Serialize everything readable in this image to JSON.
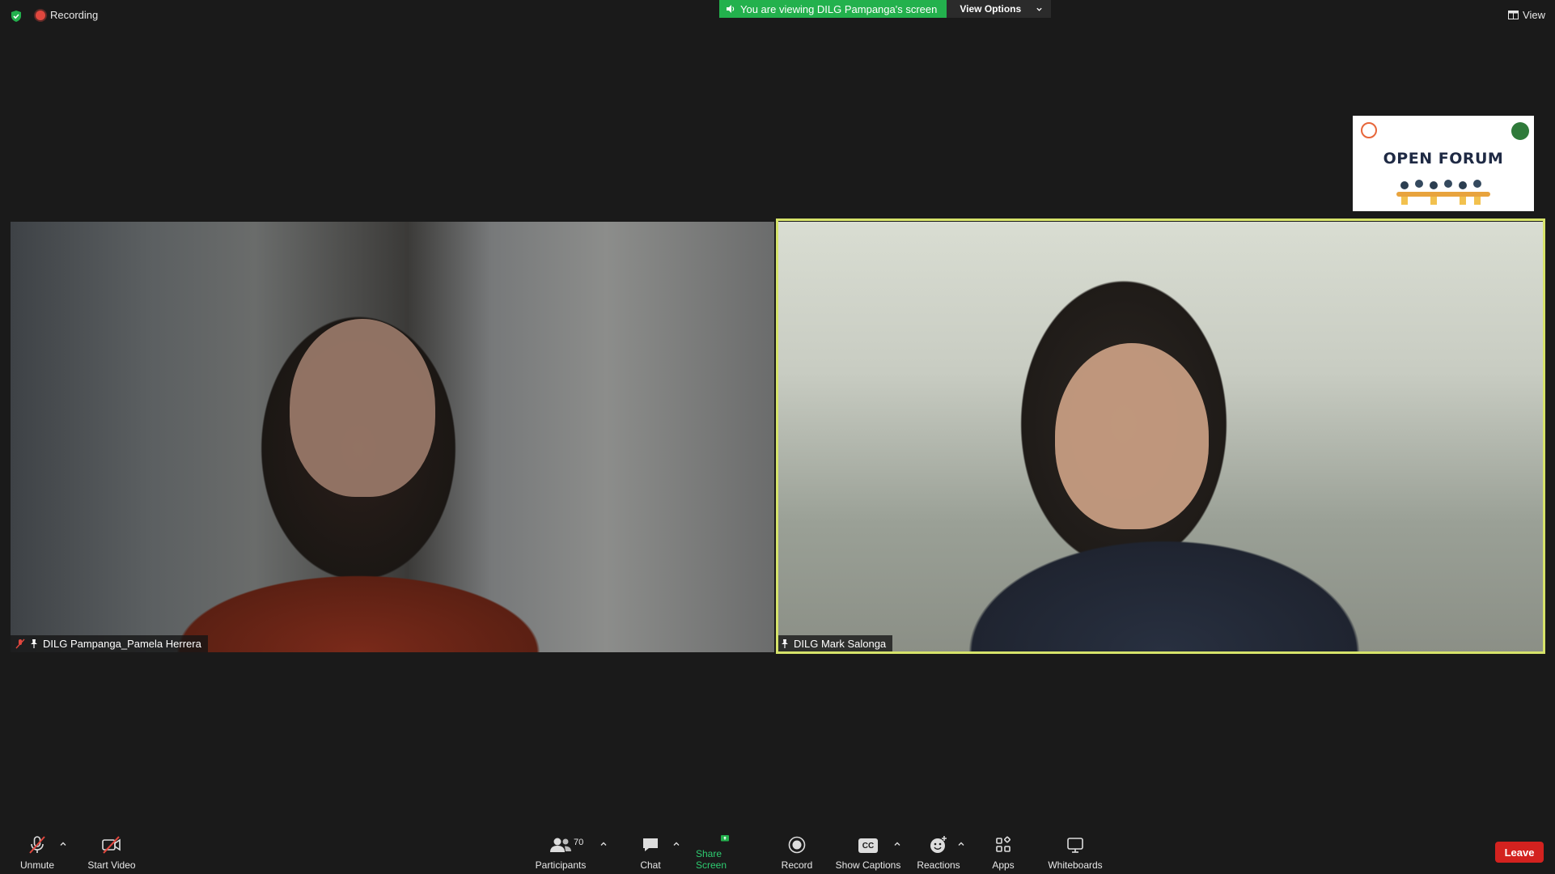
{
  "top_bar": {
    "recording_label": "Recording",
    "viewing_banner": "You are viewing DILG Pampanga's screen",
    "view_options": "View Options",
    "view_label": "View"
  },
  "thumbnail": {
    "title": "OPEN FORUM"
  },
  "participants": [
    {
      "name": "DILG Pampanga_Pamela Herrera"
    },
    {
      "name": "DILG Mark Salonga"
    }
  ],
  "toolbar": {
    "unmute": "Unmute",
    "start_video": "Start Video",
    "participants": "Participants",
    "participants_count": "70",
    "chat": "Chat",
    "share_screen": "Share Screen",
    "record": "Record",
    "show_captions": "Show Captions",
    "cc": "CC",
    "reactions": "Reactions",
    "apps": "Apps",
    "whiteboards": "Whiteboards",
    "leave": "Leave"
  },
  "colors": {
    "banner_green": "#23b14d",
    "leave_red": "#d3221f",
    "active_speaker_border": "#d6e36a",
    "share_green": "#2ecc71"
  }
}
